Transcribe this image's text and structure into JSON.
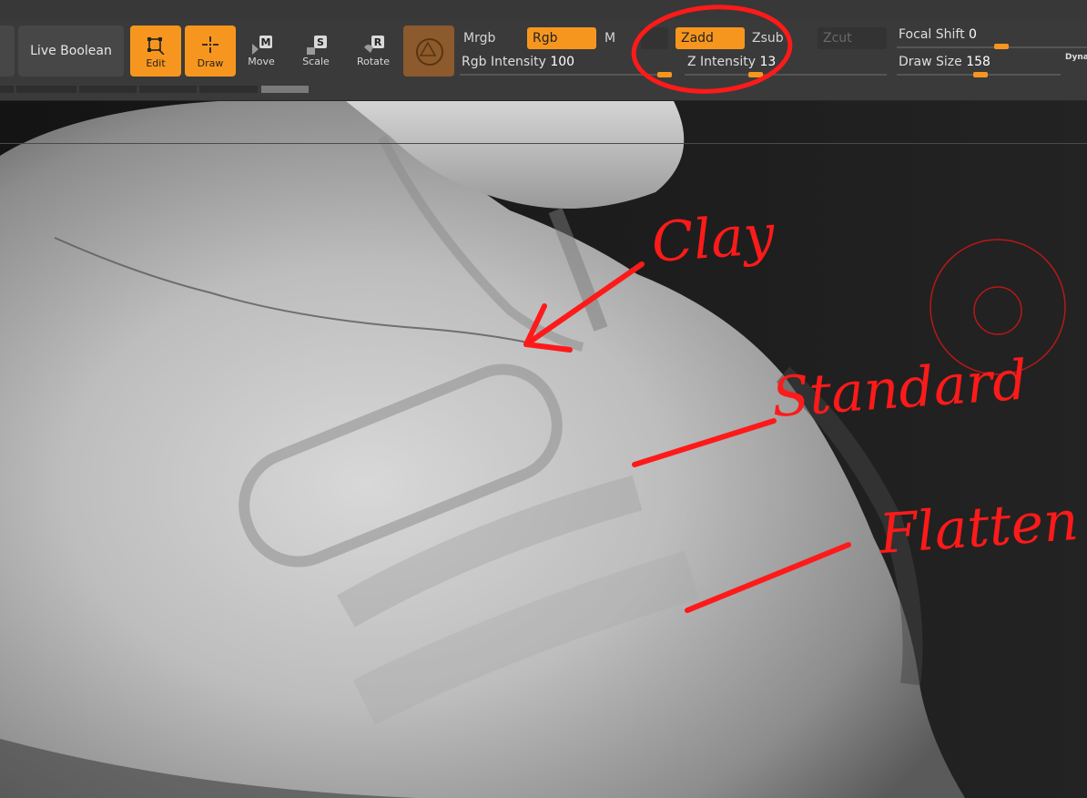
{
  "toolbar": {
    "live_boolean": "Live Boolean",
    "edit": "Edit",
    "draw": "Draw",
    "move": "Move",
    "scale": "Scale",
    "rotate": "Rotate",
    "move_key": "M",
    "scale_key": "S",
    "rotate_key": "R",
    "mrgb": "Mrgb",
    "rgb": "Rgb",
    "m": "M",
    "zadd": "Zadd",
    "zsub": "Zsub",
    "zcut": "Zcut",
    "rgb_intensity_label": "Rgb Intensity",
    "rgb_intensity_value": "100",
    "z_intensity_label": "Z Intensity",
    "z_intensity_value": "13",
    "focal_shift_label": "Focal Shift",
    "focal_shift_value": "0",
    "draw_size_label": "Draw Size",
    "draw_size_value": "158",
    "dynamic_label": "Dyna"
  },
  "annotations": {
    "clay": "Clay",
    "standard": "Standard",
    "flatten": "Flatten"
  },
  "colors": {
    "accent": "#f7961e",
    "annotation": "#ff1a1a",
    "toolbar_bg": "#3a3a3a",
    "viewport_bg": "#191919"
  }
}
